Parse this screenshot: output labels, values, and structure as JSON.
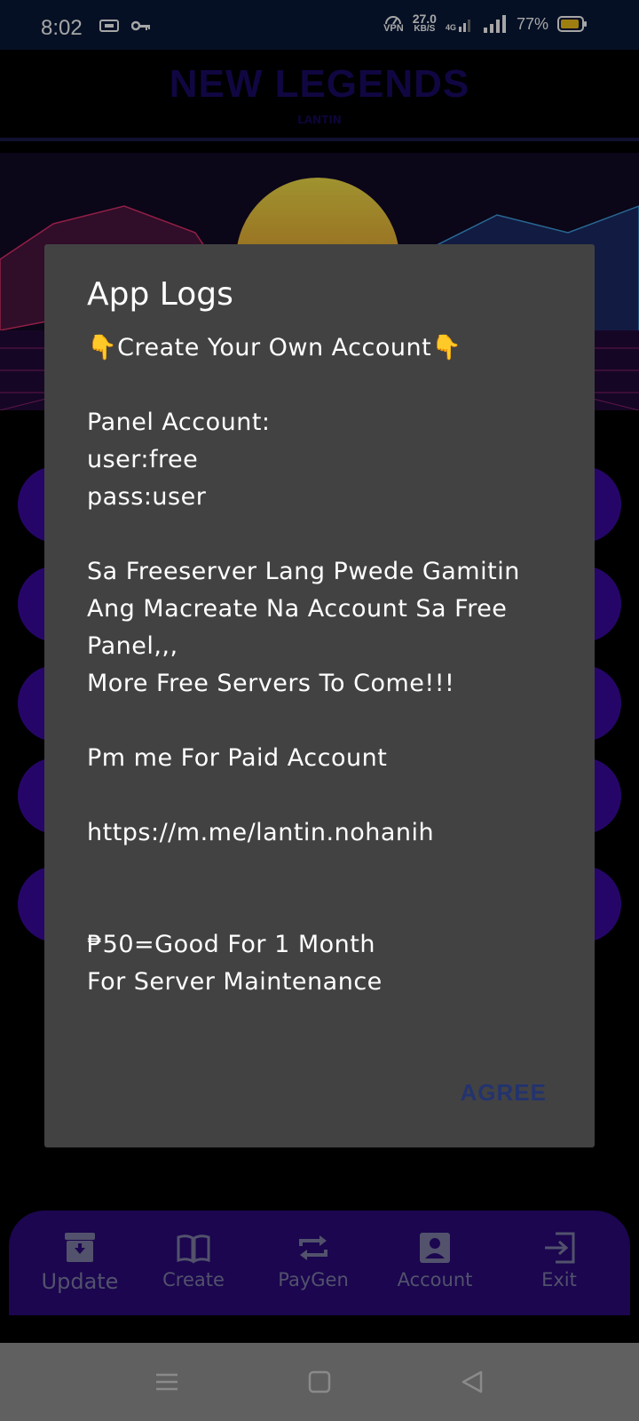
{
  "status_bar": {
    "time": "8:02",
    "speed_value": "27.0",
    "speed_unit": "KB/S",
    "vpn": "VPN",
    "network": "4G",
    "battery": "77%"
  },
  "app": {
    "title": "NEW LEGENDS",
    "subtitle": "LANTIN"
  },
  "dialog": {
    "title": "App Logs",
    "body": "👇Create Your Own Account👇\n\nPanel Account:\nuser:free\npass:user\n\nSa Freeserver Lang Pwede Gamitin Ang Macreate Na Account Sa Free Panel,,,\nMore Free Servers To Come!!!\n\nPm me For Paid Account\n\nhttps://m.me/lantin.nohanih\n\n\n₱50=Good For 1 Month\nFor Server Maintenance",
    "agree_label": "AGREE"
  },
  "bottom_nav": {
    "items": [
      {
        "label": "Update",
        "icon": "archive-download-icon"
      },
      {
        "label": "Create",
        "icon": "book-icon"
      },
      {
        "label": "PayGen",
        "icon": "repeat-icon"
      },
      {
        "label": "Account",
        "icon": "account-box-icon"
      },
      {
        "label": "Exit",
        "icon": "exit-icon"
      }
    ]
  },
  "colors": {
    "dialog_bg": "#424242",
    "nav_bg": "#2a0a7a",
    "accent": "#23336e"
  }
}
